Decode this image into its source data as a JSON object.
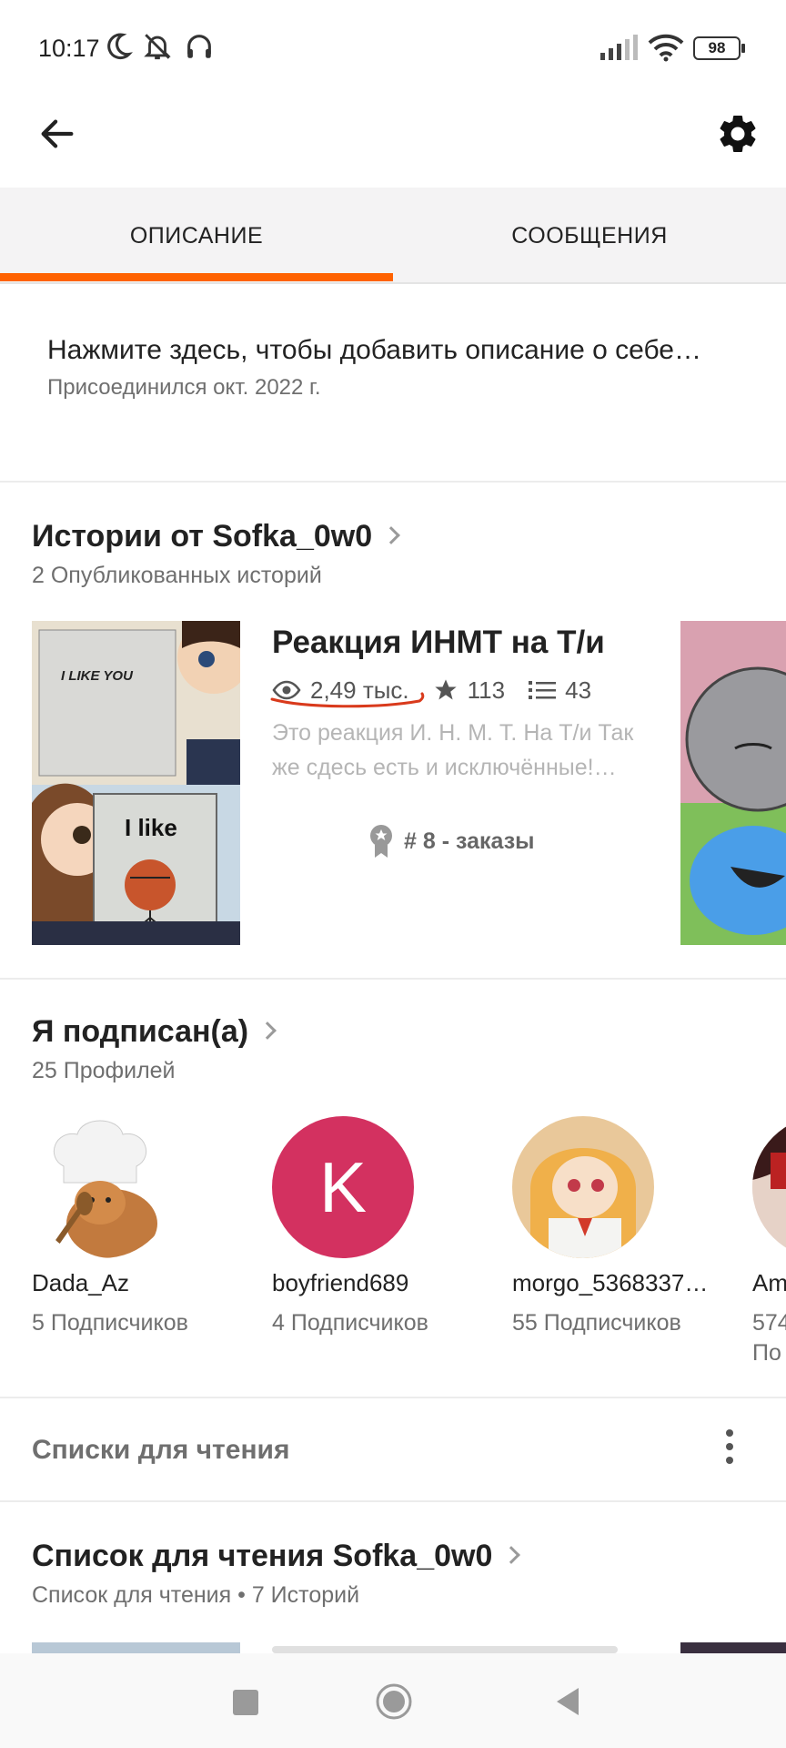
{
  "status_bar": {
    "time": "10:17",
    "battery": "98"
  },
  "tabs": [
    {
      "label": "ОПИСАНИЕ",
      "active": true
    },
    {
      "label": "СООБЩЕНИЯ",
      "active": false
    }
  ],
  "description": {
    "prompt": "Нажмите здесь, чтобы добавить описание о себе…",
    "joined": "Присоединился окт. 2022 г."
  },
  "stories_section": {
    "title": "Истории от Sofka_0w0",
    "subtitle": "2 Опубликованных историй",
    "story": {
      "title": "Реакция ИНМТ на Т/и",
      "views": "2,49 тыс.",
      "votes": "113",
      "parts": "43",
      "description": "Это реакция И. Н. М. Т. На Т/и Так же сдесь есть и исключённые!…",
      "rank": "# 8 - заказы",
      "cover_text_top": "I LIKE YOU",
      "cover_text_bottom": "I like"
    }
  },
  "following_section": {
    "title": "Я подписан(а)",
    "subtitle": "25 Профилей",
    "profiles": [
      {
        "name": "Dada_Az",
        "followers": "5 Подписчиков"
      },
      {
        "name": "boyfriend689",
        "followers": "4 Подписчиков",
        "initial": "K"
      },
      {
        "name": "morgo_5368337…",
        "followers": "55 Подписчиков"
      },
      {
        "name": "Am",
        "followers": "574",
        "followers_line2": "По"
      }
    ]
  },
  "reading_lists": {
    "label": "Списки для чтения",
    "list_title": "Список для чтения Sofka_0w0",
    "list_subtitle": "Список для чтения • 7 Историй"
  },
  "colors": {
    "accent": "#ff6200",
    "avatar_k": "#d33160",
    "tab_bg": "#f4f3f4"
  }
}
